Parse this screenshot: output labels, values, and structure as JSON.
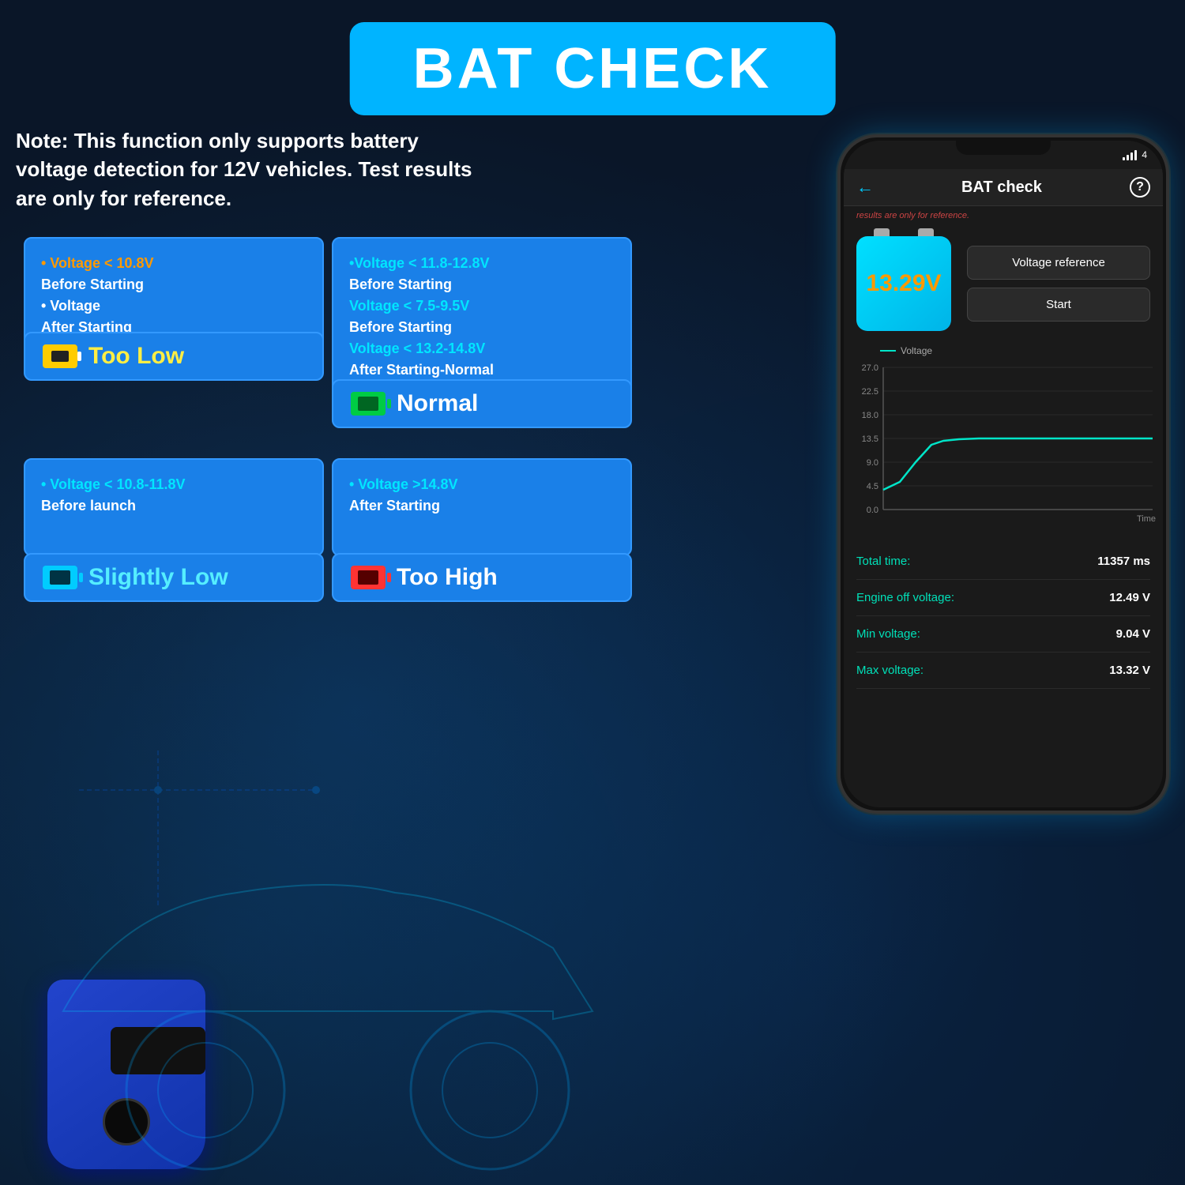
{
  "title": "BAT CHECK",
  "note": "Note:  This function only supports battery voltage detection for 12V vehicles. Test results are only for reference.",
  "boxes": {
    "too_low": {
      "info_line1": "• Voltage < 10.8V",
      "info_line2": "  Before Starting",
      "info_line3": "• Voltage",
      "info_line4": "  After Starting",
      "label": "Too Low"
    },
    "normal": {
      "info_line1": "•Voltage < 11.8-12.8V",
      "info_line2": "  Before Starting",
      "info_line3": "  Voltage < 7.5-9.5V",
      "info_line4": "  Before Starting",
      "info_line5": "  Voltage < 13.2-14.8V",
      "info_line6": "  After Starting-Normal",
      "label": "Normal"
    },
    "slightly_low": {
      "info_line1": "• Voltage < 10.8-11.8V",
      "info_line2": "  Before launch",
      "label": "Slightly Low"
    },
    "too_high": {
      "info_line1": "• Voltage >14.8V",
      "info_line2": "  After Starting",
      "label": "Too High"
    }
  },
  "phone": {
    "title": "BAT check",
    "signal": "4",
    "subtitle": "results are only for reference.",
    "voltage_display": "13.29V",
    "btn_voltage_ref": "Voltage reference",
    "btn_start": "Start",
    "chart": {
      "y_labels": [
        "27.0",
        "22.5",
        "18.0",
        "13.5",
        "9.0",
        "4.5",
        "0.0"
      ],
      "x_label": "Time",
      "legend_label": "Voltage"
    },
    "stats": [
      {
        "label": "Total time:",
        "value": "11357 ms"
      },
      {
        "label": "Engine off voltage:",
        "value": "12.49 V"
      },
      {
        "label": "Min voltage:",
        "value": "9.04 V"
      },
      {
        "label": "Max voltage:",
        "value": "13.32 V"
      }
    ]
  }
}
